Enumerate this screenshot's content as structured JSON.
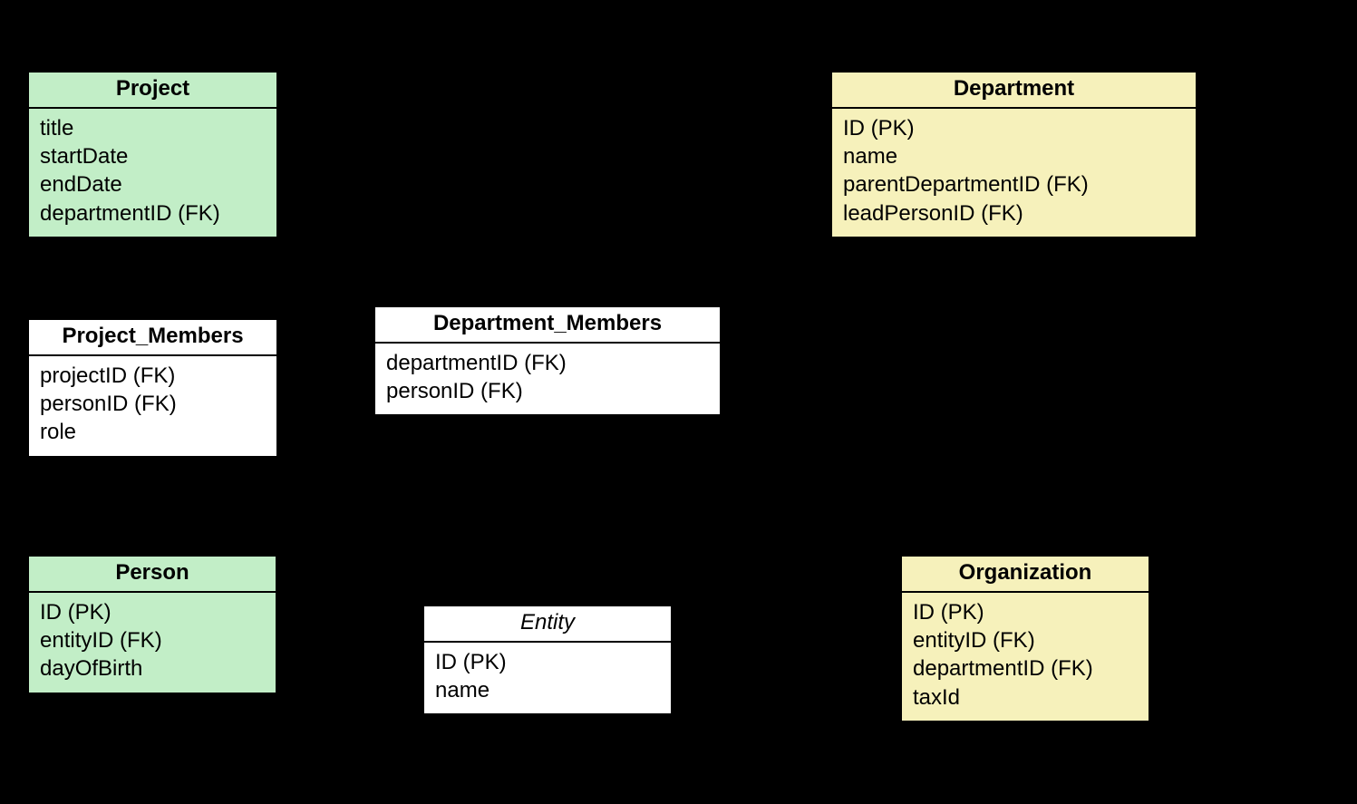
{
  "entities": {
    "project": {
      "title": "Project",
      "attrs": [
        "title",
        "startDate",
        "endDate",
        "departmentID (FK)"
      ]
    },
    "department": {
      "title": "Department",
      "attrs": [
        "ID (PK)",
        "name",
        "parentDepartmentID (FK)",
        "leadPersonID (FK)"
      ]
    },
    "project_members": {
      "title": "Project_Members",
      "attrs": [
        "projectID (FK)",
        "personID (FK)",
        "role"
      ]
    },
    "department_members": {
      "title": "Department_Members",
      "attrs": [
        "departmentID (FK)",
        "personID (FK)"
      ]
    },
    "person": {
      "title": "Person",
      "attrs": [
        "ID (PK)",
        "entityID (FK)",
        "dayOfBirth"
      ]
    },
    "entity": {
      "title": "Entity",
      "attrs": [
        "ID (PK)",
        "name"
      ]
    },
    "organization": {
      "title": "Organization",
      "attrs": [
        "ID (PK)",
        "entityID (FK)",
        "departmentID (FK)",
        "taxId"
      ]
    }
  }
}
